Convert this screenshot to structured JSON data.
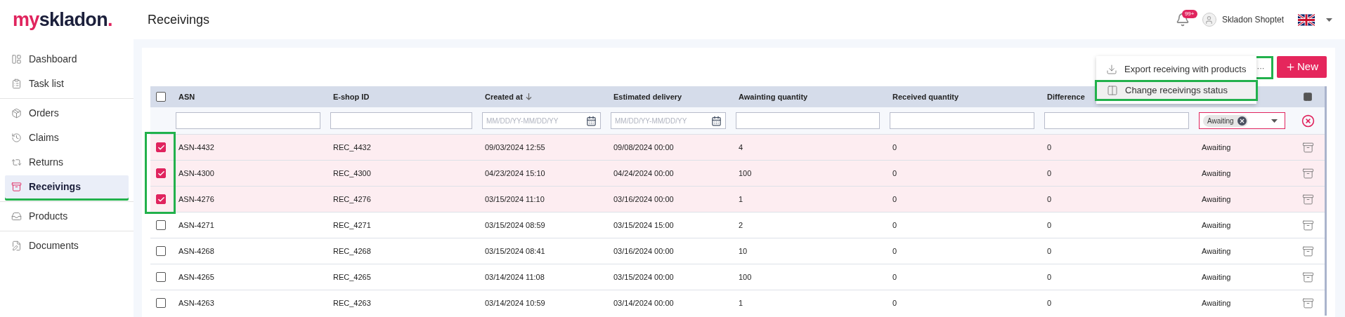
{
  "app": {
    "logo": {
      "accent": "my",
      "main": "skladon",
      "dot": "."
    },
    "page_title": "Receivings"
  },
  "header": {
    "notifications_badge": "99+",
    "user_name": "Skladon Shoptet"
  },
  "sidebar": {
    "groups": [
      [
        {
          "label": "Dashboard",
          "kind": "dashboard",
          "selected": false,
          "highlighted": false
        },
        {
          "label": "Task list",
          "kind": "tasks",
          "selected": false,
          "highlighted": false
        }
      ],
      [
        {
          "label": "Orders",
          "kind": "orders",
          "selected": false,
          "highlighted": false
        },
        {
          "label": "Claims",
          "kind": "claims",
          "selected": false,
          "highlighted": false
        },
        {
          "label": "Returns",
          "kind": "returns",
          "selected": false,
          "highlighted": false
        },
        {
          "label": "Receivings",
          "kind": "receivings",
          "selected": true,
          "highlighted": true
        }
      ],
      [
        {
          "label": "Products",
          "kind": "products",
          "selected": false,
          "highlighted": false
        }
      ],
      [
        {
          "label": "Documents",
          "kind": "documents",
          "selected": false,
          "highlighted": false
        }
      ]
    ]
  },
  "toolbar": {
    "more_button": {
      "label": "···",
      "highlighted": true
    },
    "new_button": {
      "label": "New"
    },
    "menu": [
      {
        "label": "Export receiving with products",
        "kind": "export",
        "highlighted": false
      },
      {
        "label": "Change receivings status",
        "kind": "status",
        "highlighted": true
      }
    ]
  },
  "table": {
    "select_column_highlighted": true,
    "all_checked": false,
    "columns": [
      {
        "label": "ASN",
        "kind": "text"
      },
      {
        "label": "E-shop ID",
        "kind": "text"
      },
      {
        "label": "Created at",
        "kind": "date",
        "sorted": true,
        "placeholder": "MM/DD/YY-MM/DD/YY"
      },
      {
        "label": "Estimated delivery",
        "kind": "date",
        "sorted": false,
        "placeholder": "MM/DD/YY-MM/DD/YY"
      },
      {
        "label": "Awainting quantity",
        "kind": "text"
      },
      {
        "label": "Received quantity",
        "kind": "text"
      },
      {
        "label": "Difference",
        "kind": "text"
      },
      {
        "kind": "status"
      }
    ],
    "status_filter_chip": "Awaiting",
    "rows": [
      {
        "checked": true,
        "cells": [
          "ASN-4432",
          "REC_4432",
          "09/03/2024 12:55",
          "09/08/2024 00:00",
          "4",
          "0",
          "0",
          "Awaiting"
        ]
      },
      {
        "checked": true,
        "cells": [
          "ASN-4300",
          "REC_4300",
          "04/23/2024 15:10",
          "04/24/2024 00:00",
          "100",
          "0",
          "0",
          "Awaiting"
        ]
      },
      {
        "checked": true,
        "cells": [
          "ASN-4276",
          "REC_4276",
          "03/15/2024 11:10",
          "03/16/2024 00:00",
          "1",
          "0",
          "0",
          "Awaiting"
        ]
      },
      {
        "checked": false,
        "cells": [
          "ASN-4271",
          "REC_4271",
          "03/15/2024 08:59",
          "03/15/2024 15:00",
          "2",
          "0",
          "0",
          "Awaiting"
        ]
      },
      {
        "checked": false,
        "cells": [
          "ASN-4268",
          "REC_4268",
          "03/15/2024 08:41",
          "03/16/2024 00:00",
          "10",
          "0",
          "0",
          "Awaiting"
        ]
      },
      {
        "checked": false,
        "cells": [
          "ASN-4265",
          "REC_4265",
          "03/14/2024 11:08",
          "03/15/2024 00:00",
          "100",
          "0",
          "0",
          "Awaiting"
        ]
      },
      {
        "checked": false,
        "cells": [
          "ASN-4263",
          "REC_4263",
          "03/14/2024 10:59",
          "03/14/2024 00:00",
          "1",
          "0",
          "0",
          "Awaiting"
        ]
      }
    ]
  }
}
